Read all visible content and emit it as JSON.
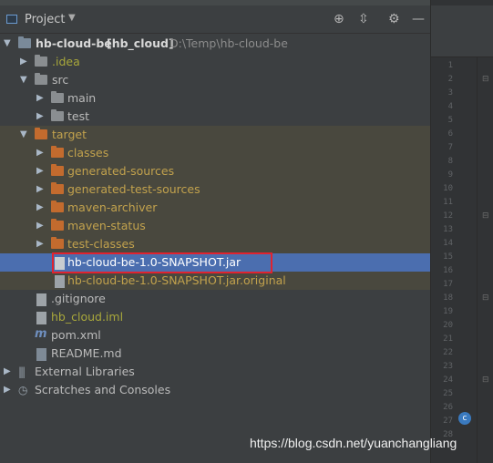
{
  "header": {
    "title": "Project",
    "dropdown_icon": "chevron-down-icon",
    "actions": [
      "locate-icon",
      "collapse-all-icon",
      "settings-gear-icon",
      "hide-icon"
    ]
  },
  "tree": {
    "root_name": "hb-cloud-be",
    "root_module": "[hb_cloud]",
    "root_path": "D:\\Temp\\hb-cloud-be",
    "idea": ".idea",
    "src": "src",
    "main": "main",
    "test": "test",
    "target": "target",
    "classes": "classes",
    "generated_sources": "generated-sources",
    "generated_test_sources": "generated-test-sources",
    "maven_archiver": "maven-archiver",
    "maven_status": "maven-status",
    "test_classes": "test-classes",
    "jar": "hb-cloud-be-1.0-SNAPSHOT.jar",
    "jar_original": "hb-cloud-be-1.0-SNAPSHOT.jar.original",
    "gitignore": ".gitignore",
    "iml": "hb_cloud.iml",
    "pom": "pom.xml",
    "readme": "README.md",
    "external_libraries": "External Libraries",
    "scratches": "Scratches and Consoles"
  },
  "gutter": {
    "line_numbers": [
      "1",
      "2",
      "3",
      "4",
      "5",
      "6",
      "7",
      "8",
      "9",
      "10",
      "11",
      "12",
      "13",
      "14",
      "15",
      "16",
      "17",
      "18",
      "19",
      "20",
      "21",
      "22",
      "23",
      "24",
      "25",
      "26",
      "27",
      "28"
    ]
  },
  "watermark": "https://blog.csdn.net/yuanchangliang",
  "colors": {
    "selection": "#4b6eaf",
    "target_highlight": "#49483e",
    "annotation_box": "#e0232f"
  }
}
